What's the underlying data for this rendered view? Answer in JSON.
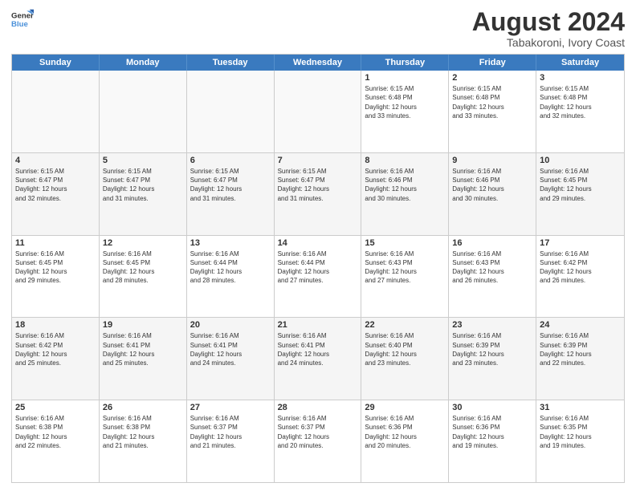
{
  "logo": {
    "line1": "General",
    "line2": "Blue"
  },
  "title": "August 2024",
  "subtitle": "Tabakoroni, Ivory Coast",
  "days": [
    "Sunday",
    "Monday",
    "Tuesday",
    "Wednesday",
    "Thursday",
    "Friday",
    "Saturday"
  ],
  "rows": [
    [
      {
        "num": "",
        "info": "",
        "empty": true
      },
      {
        "num": "",
        "info": "",
        "empty": true
      },
      {
        "num": "",
        "info": "",
        "empty": true
      },
      {
        "num": "",
        "info": "",
        "empty": true
      },
      {
        "num": "1",
        "info": "Sunrise: 6:15 AM\nSunset: 6:48 PM\nDaylight: 12 hours\nand 33 minutes."
      },
      {
        "num": "2",
        "info": "Sunrise: 6:15 AM\nSunset: 6:48 PM\nDaylight: 12 hours\nand 33 minutes."
      },
      {
        "num": "3",
        "info": "Sunrise: 6:15 AM\nSunset: 6:48 PM\nDaylight: 12 hours\nand 32 minutes."
      }
    ],
    [
      {
        "num": "4",
        "info": "Sunrise: 6:15 AM\nSunset: 6:47 PM\nDaylight: 12 hours\nand 32 minutes."
      },
      {
        "num": "5",
        "info": "Sunrise: 6:15 AM\nSunset: 6:47 PM\nDaylight: 12 hours\nand 31 minutes."
      },
      {
        "num": "6",
        "info": "Sunrise: 6:15 AM\nSunset: 6:47 PM\nDaylight: 12 hours\nand 31 minutes."
      },
      {
        "num": "7",
        "info": "Sunrise: 6:15 AM\nSunset: 6:47 PM\nDaylight: 12 hours\nand 31 minutes."
      },
      {
        "num": "8",
        "info": "Sunrise: 6:16 AM\nSunset: 6:46 PM\nDaylight: 12 hours\nand 30 minutes."
      },
      {
        "num": "9",
        "info": "Sunrise: 6:16 AM\nSunset: 6:46 PM\nDaylight: 12 hours\nand 30 minutes."
      },
      {
        "num": "10",
        "info": "Sunrise: 6:16 AM\nSunset: 6:45 PM\nDaylight: 12 hours\nand 29 minutes."
      }
    ],
    [
      {
        "num": "11",
        "info": "Sunrise: 6:16 AM\nSunset: 6:45 PM\nDaylight: 12 hours\nand 29 minutes."
      },
      {
        "num": "12",
        "info": "Sunrise: 6:16 AM\nSunset: 6:45 PM\nDaylight: 12 hours\nand 28 minutes."
      },
      {
        "num": "13",
        "info": "Sunrise: 6:16 AM\nSunset: 6:44 PM\nDaylight: 12 hours\nand 28 minutes."
      },
      {
        "num": "14",
        "info": "Sunrise: 6:16 AM\nSunset: 6:44 PM\nDaylight: 12 hours\nand 27 minutes."
      },
      {
        "num": "15",
        "info": "Sunrise: 6:16 AM\nSunset: 6:43 PM\nDaylight: 12 hours\nand 27 minutes."
      },
      {
        "num": "16",
        "info": "Sunrise: 6:16 AM\nSunset: 6:43 PM\nDaylight: 12 hours\nand 26 minutes."
      },
      {
        "num": "17",
        "info": "Sunrise: 6:16 AM\nSunset: 6:42 PM\nDaylight: 12 hours\nand 26 minutes."
      }
    ],
    [
      {
        "num": "18",
        "info": "Sunrise: 6:16 AM\nSunset: 6:42 PM\nDaylight: 12 hours\nand 25 minutes."
      },
      {
        "num": "19",
        "info": "Sunrise: 6:16 AM\nSunset: 6:41 PM\nDaylight: 12 hours\nand 25 minutes."
      },
      {
        "num": "20",
        "info": "Sunrise: 6:16 AM\nSunset: 6:41 PM\nDaylight: 12 hours\nand 24 minutes."
      },
      {
        "num": "21",
        "info": "Sunrise: 6:16 AM\nSunset: 6:41 PM\nDaylight: 12 hours\nand 24 minutes."
      },
      {
        "num": "22",
        "info": "Sunrise: 6:16 AM\nSunset: 6:40 PM\nDaylight: 12 hours\nand 23 minutes."
      },
      {
        "num": "23",
        "info": "Sunrise: 6:16 AM\nSunset: 6:39 PM\nDaylight: 12 hours\nand 23 minutes."
      },
      {
        "num": "24",
        "info": "Sunrise: 6:16 AM\nSunset: 6:39 PM\nDaylight: 12 hours\nand 22 minutes."
      }
    ],
    [
      {
        "num": "25",
        "info": "Sunrise: 6:16 AM\nSunset: 6:38 PM\nDaylight: 12 hours\nand 22 minutes."
      },
      {
        "num": "26",
        "info": "Sunrise: 6:16 AM\nSunset: 6:38 PM\nDaylight: 12 hours\nand 21 minutes."
      },
      {
        "num": "27",
        "info": "Sunrise: 6:16 AM\nSunset: 6:37 PM\nDaylight: 12 hours\nand 21 minutes."
      },
      {
        "num": "28",
        "info": "Sunrise: 6:16 AM\nSunset: 6:37 PM\nDaylight: 12 hours\nand 20 minutes."
      },
      {
        "num": "29",
        "info": "Sunrise: 6:16 AM\nSunset: 6:36 PM\nDaylight: 12 hours\nand 20 minutes."
      },
      {
        "num": "30",
        "info": "Sunrise: 6:16 AM\nSunset: 6:36 PM\nDaylight: 12 hours\nand 19 minutes."
      },
      {
        "num": "31",
        "info": "Sunrise: 6:16 AM\nSunset: 6:35 PM\nDaylight: 12 hours\nand 19 minutes."
      }
    ]
  ]
}
